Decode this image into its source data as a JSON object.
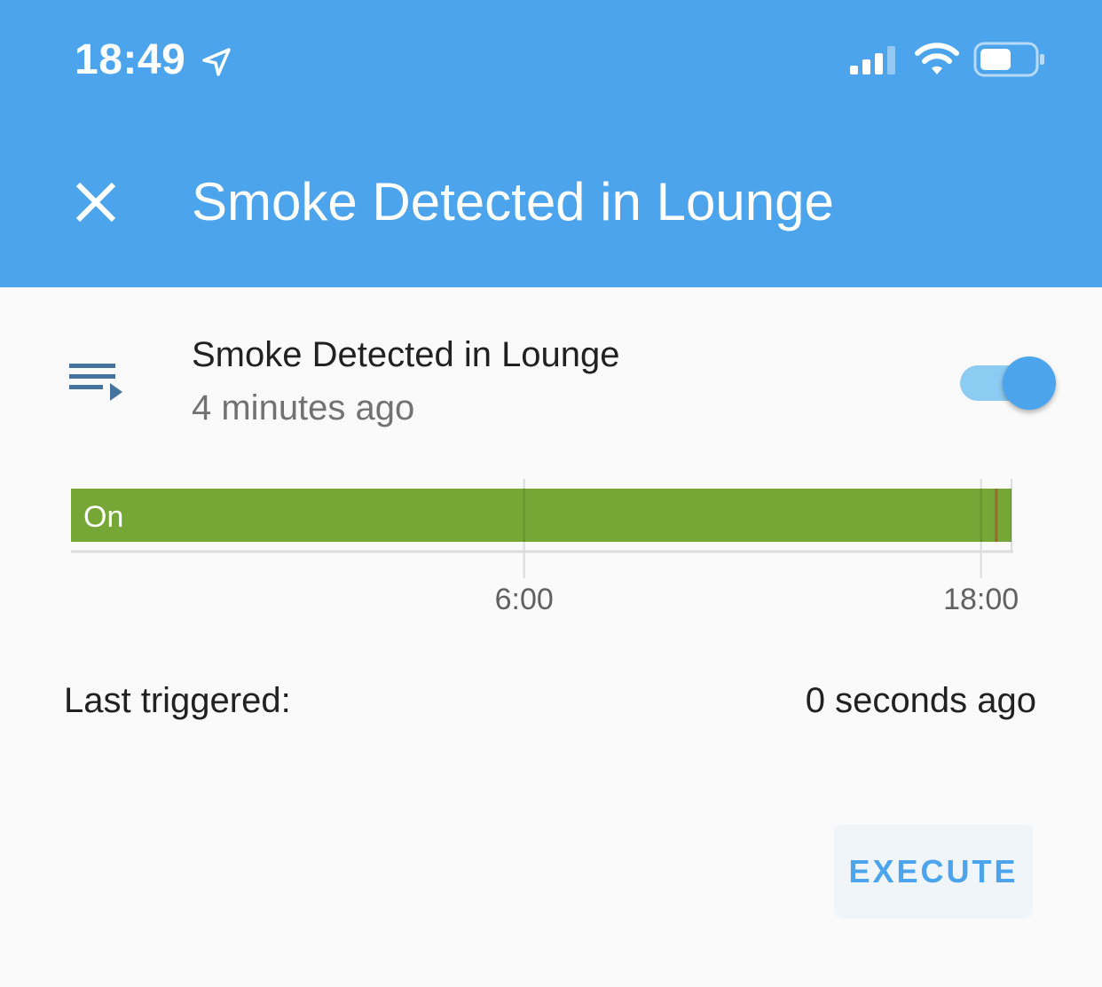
{
  "status_bar": {
    "time": "18:49",
    "location_icon": "location-arrow-icon",
    "signal_icon": "cellular-signal-icon",
    "wifi_icon": "wifi-icon",
    "battery_icon": "battery-icon"
  },
  "header": {
    "title": "Smoke Detected in Lounge",
    "close_icon": "close-icon",
    "background_color": "#4ba4ec"
  },
  "entity": {
    "icon": "script-icon",
    "name": "Smoke Detected in Lounge",
    "last_changed": "4 minutes ago",
    "toggle_state": "on",
    "accent_color": "#4ba4ec"
  },
  "chart_data": {
    "type": "timeline",
    "segments": [
      {
        "state": "On",
        "label": "On",
        "color": "#76a636",
        "start_hour": -5.9,
        "end_hour": 18.8
      }
    ],
    "markers": [
      {
        "hour": 18.4,
        "color": "#a0662e"
      }
    ],
    "x_ticks": [
      {
        "hour": 6,
        "label": "6:00"
      },
      {
        "hour": 18,
        "label": "18:00"
      }
    ],
    "x_range": [
      -5.9,
      18.8
    ],
    "grid": true
  },
  "details": {
    "last_triggered_label": "Last triggered:",
    "last_triggered_value": "0 seconds ago"
  },
  "actions": {
    "execute_label": "EXECUTE"
  }
}
